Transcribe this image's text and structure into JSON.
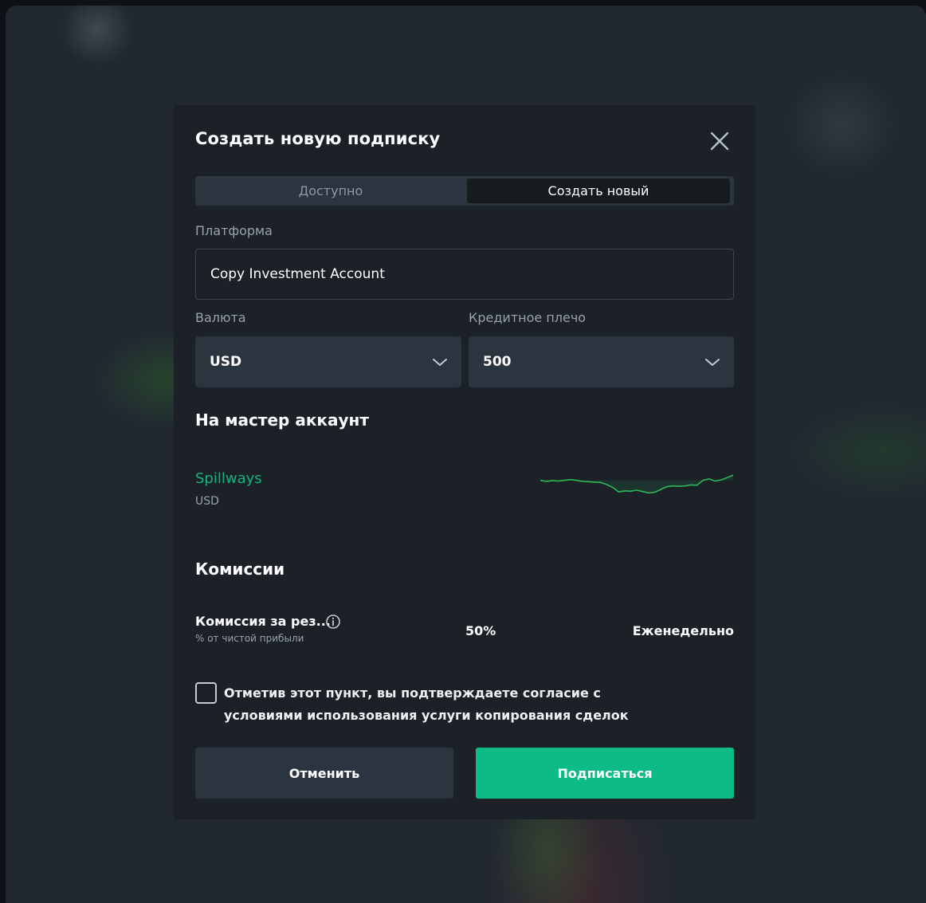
{
  "modal": {
    "title": "Создать новую подписку",
    "close_icon": "close-icon"
  },
  "tabs": [
    {
      "label": "Доступно",
      "active": false
    },
    {
      "label": "Создать новый",
      "active": true
    }
  ],
  "platform": {
    "label": "Платформа",
    "value": "Copy Investment Account"
  },
  "currency": {
    "label": "Валюта",
    "value": "USD"
  },
  "leverage": {
    "label": "Кредитное плечо",
    "value": "500"
  },
  "master": {
    "section_title": "На мастер аккаунт",
    "name": "Spillways",
    "currency": "USD",
    "sparkline_color": "#2fb55a",
    "sparkline": [
      0.78,
      0.75,
      0.77,
      0.76,
      0.78,
      0.8,
      0.78,
      0.75,
      0.74,
      0.73,
      0.72,
      0.66,
      0.58,
      0.45,
      0.48,
      0.47,
      0.5,
      0.46,
      0.42,
      0.44,
      0.52,
      0.6,
      0.62,
      0.61,
      0.62,
      0.65,
      0.64,
      0.78,
      0.82,
      0.76,
      0.79,
      0.86,
      0.93
    ]
  },
  "fees": {
    "section_title": "Комиссии",
    "items": [
      {
        "name": "Комиссия за рез...",
        "subtitle": "% от чистой прибыли",
        "value": "50%",
        "period": "Еженедельно"
      }
    ]
  },
  "consent": {
    "text": "Отметив этот пункт, вы подтверждаете согласие с условиями использования услуги копирования сделок",
    "checked": false
  },
  "actions": {
    "cancel_label": "Отменить",
    "subscribe_label": "Подписаться"
  },
  "colors": {
    "accent": "#0cbc84",
    "master_name": "#16b47a",
    "modal_bg": "#1b2127",
    "field_bg": "#2a3540"
  }
}
